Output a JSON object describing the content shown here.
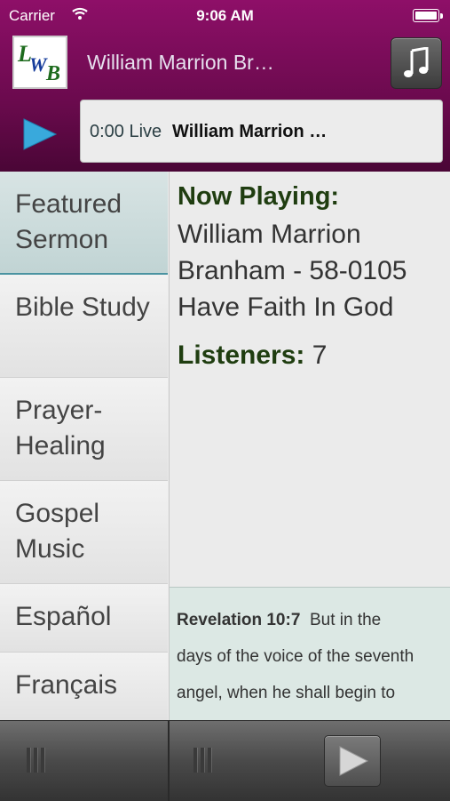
{
  "status": {
    "carrier": "Carrier",
    "time": "9:06 AM"
  },
  "header": {
    "logo_letters": {
      "l": "L",
      "w": "W",
      "b": "B"
    },
    "title": "William Marrion Br…",
    "music_icon": "music-note-icon"
  },
  "player": {
    "time": "0:00 Live",
    "track": "William Marrion …"
  },
  "sidebar": {
    "items": [
      {
        "label": "Featured Sermon",
        "active": true
      },
      {
        "label": "Bible Study"
      },
      {
        "label": "Prayer-Healing"
      },
      {
        "label": "Gospel Music"
      },
      {
        "label": "Español"
      },
      {
        "label": "Français"
      }
    ]
  },
  "now_playing": {
    "label": "Now Playing:",
    "title": "William Marrion Branham - 58-0105 Have Faith In God",
    "listeners_label": "Listeners:",
    "listeners_count": "7"
  },
  "verse": {
    "reference": "Revelation 10:7",
    "text": "But in the days of the voice of the seventh angel, when he shall begin to sound, the mystery of"
  },
  "colors": {
    "header": "#7a0c58",
    "accent_green": "#1f3d10",
    "play_blue": "#39a9dc"
  }
}
